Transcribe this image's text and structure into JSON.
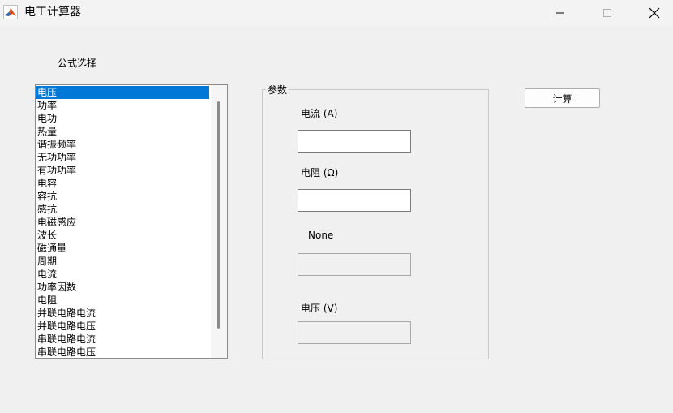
{
  "window": {
    "title": "电工计算器",
    "app_icon": "matlab-icon",
    "controls": [
      "minimize-icon",
      "maximize-icon",
      "close-icon"
    ]
  },
  "formula_label": "公式选择",
  "formula_list": {
    "selected_index": 0,
    "items": [
      "电压",
      "功率",
      "电功",
      "热量",
      "谐振频率",
      "无功功率",
      "有功功率",
      "电容",
      "容抗",
      "感抗",
      "电磁感应",
      "波长",
      "磁通量",
      "周期",
      "电流",
      "功率因数",
      "电阻",
      "并联电路电流",
      "并联电路电压",
      "串联电路电流",
      "串联电路电压"
    ]
  },
  "params": {
    "title": "参数",
    "field1_label": "电流 (A)",
    "field1_value": "",
    "field2_label": "电阻 (Ω)",
    "field2_value": "",
    "field3_label": "None",
    "field3_value": "",
    "result_label": "电压 (V)",
    "result_value": ""
  },
  "calculate_button": "计算",
  "colors": {
    "selection": "#0078d7",
    "background": "#f0f0f0"
  }
}
